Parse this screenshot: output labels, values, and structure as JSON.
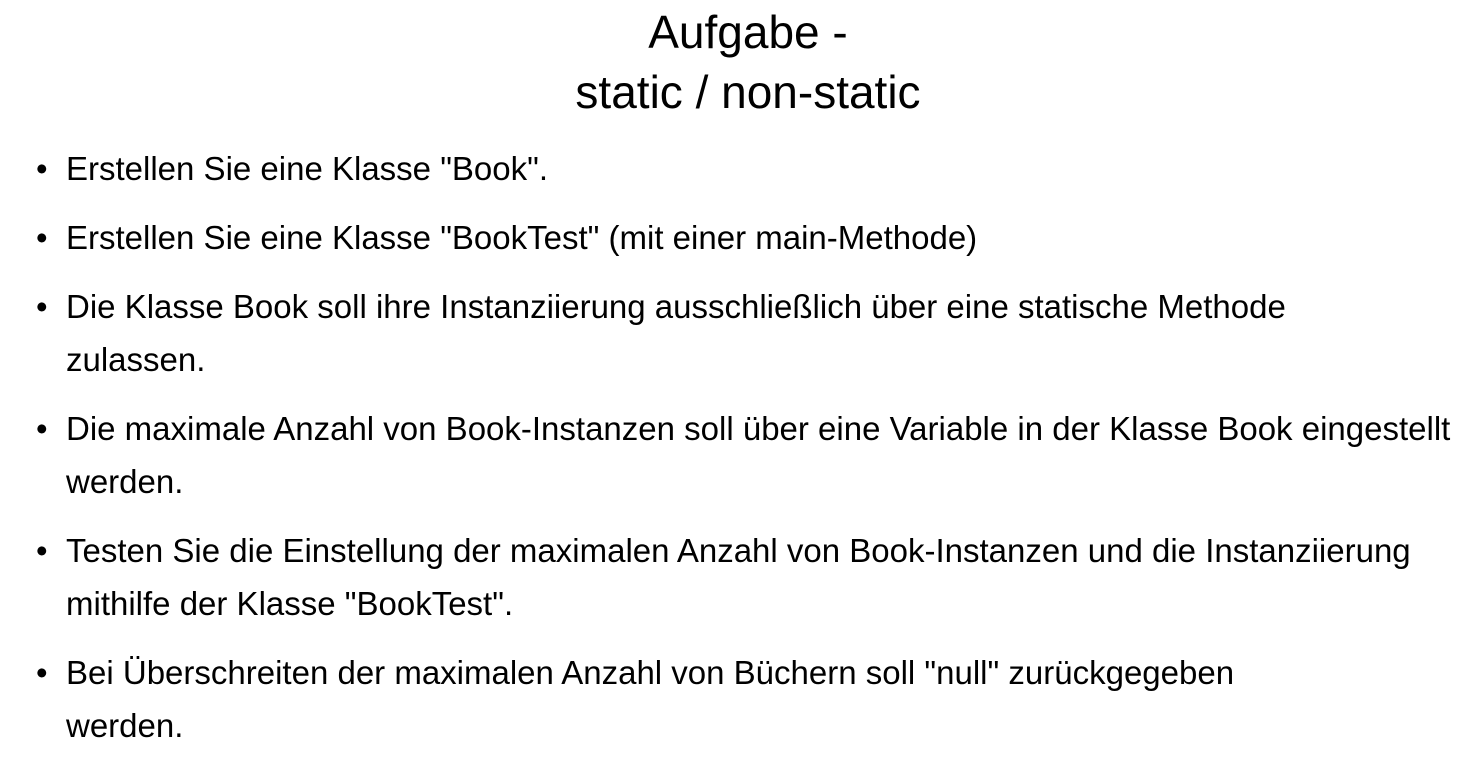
{
  "slide": {
    "title_line1": "Aufgabe -",
    "title_line2": "static / non-static",
    "bullet_symbol": "•",
    "bullets": [
      "Erstellen Sie eine Klasse \"Book\".",
      "Erstellen Sie eine Klasse \"BookTest\" (mit einer main-Methode)",
      "Die Klasse Book soll ihre Instanziierung ausschließlich über eine statische Methode zulassen.",
      "Die maximale Anzahl von Book-Instanzen soll über eine Variable in der Klasse Book eingestellt werden.",
      "Testen Sie die Einstellung der maximalen Anzahl von Book-Instanzen und die Instanziierung mithilfe der Klasse \"BookTest\".",
      "Bei Überschreiten der maximalen Anzahl von Büchern soll \"null\" zurückgegeben werden."
    ]
  }
}
